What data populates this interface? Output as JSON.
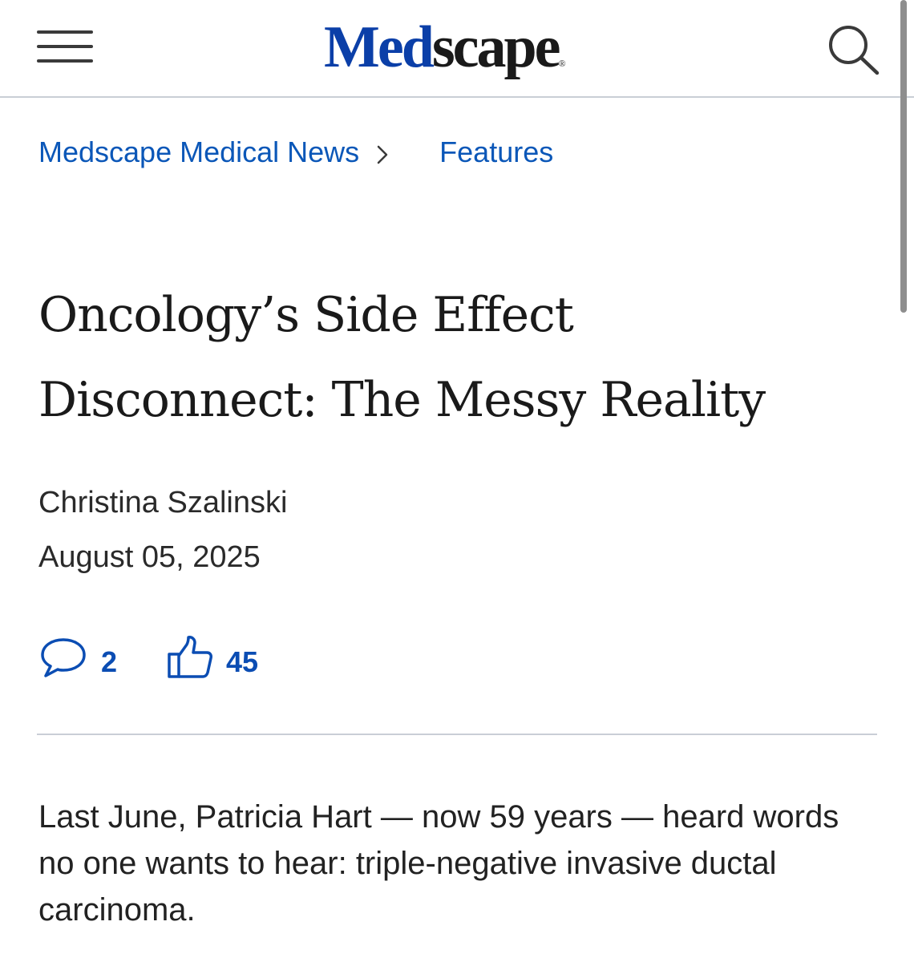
{
  "header": {
    "menu_icon": "hamburger-menu-icon",
    "logo": {
      "part1": "Med",
      "part2": "scape",
      "mark": "®"
    },
    "search_icon": "search-icon"
  },
  "breadcrumb": {
    "items": [
      "Medscape Medical News",
      "Features"
    ],
    "separator_icon": "chevron-right-icon"
  },
  "article": {
    "title": "Oncology’s Side Effect Disconnect: The Messy Reality",
    "author": "Christina Szalinski",
    "date": "August 05, 2025",
    "comments": {
      "icon": "comment-icon",
      "count": "2"
    },
    "likes": {
      "icon": "thumbs-up-icon",
      "count": "45"
    },
    "body": "Last June, Patricia Hart — now 59 years — heard words no one wants to hear: triple-negative invasive ductal carcinoma."
  },
  "colors": {
    "brand_blue": "#0b3fa8",
    "link_blue": "#0b57b8",
    "divider": "#c9ced6",
    "text": "#1a1a1a"
  }
}
